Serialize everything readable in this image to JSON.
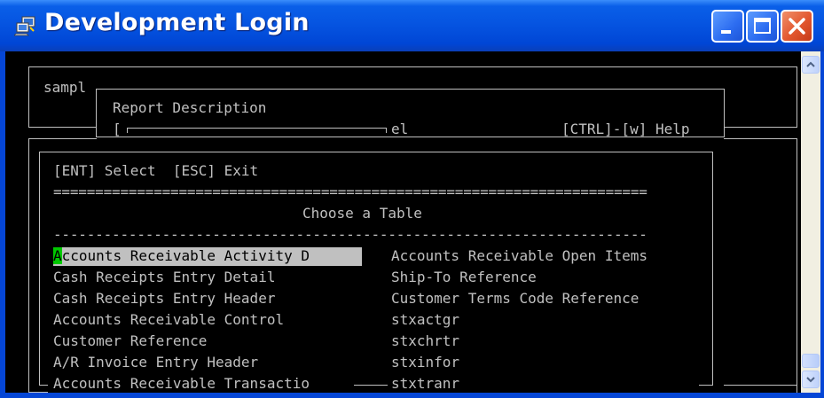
{
  "window": {
    "title": "Development Login"
  },
  "terminal": {
    "outer_label": "sampl",
    "report": {
      "label": "Report Description",
      "field_left": "[",
      "field_right": "el",
      "help_hint": "[CTRL]-[w] Help"
    },
    "dialog": {
      "keys_line": "[ENT] Select  [ESC] Exit",
      "separator_double": "=======================================================================",
      "heading": "Choose a Table",
      "separator_single": "-----------------------------------------------------------------------",
      "selected_first_char": "A",
      "selected_rest": "ccounts Receivable Activity D",
      "left_items": [
        "Accounts Receivable Activity D",
        "Cash Receipts Entry Detail",
        "Cash Receipts Entry Header",
        "Accounts Receivable Control",
        "Customer Reference",
        "A/R Invoice Entry Header",
        "Accounts Receivable Transactio"
      ],
      "right_items": [
        "Accounts Receivable Open Items",
        "Ship-To Reference",
        "Customer Terms Code Reference",
        "stxactgr",
        "stxchrtr",
        "stxinfor",
        "stxtranr"
      ]
    }
  },
  "colors": {
    "terminal_bg": "#000000",
    "terminal_fg": "#c0c0c0",
    "cursor": "#00c800",
    "titlebar": "#0553e0",
    "close_button": "#e2572f"
  },
  "icons": [
    "app-icon",
    "minimize-icon",
    "maximize-icon",
    "close-icon",
    "scroll-up-icon",
    "scroll-down-icon"
  ]
}
